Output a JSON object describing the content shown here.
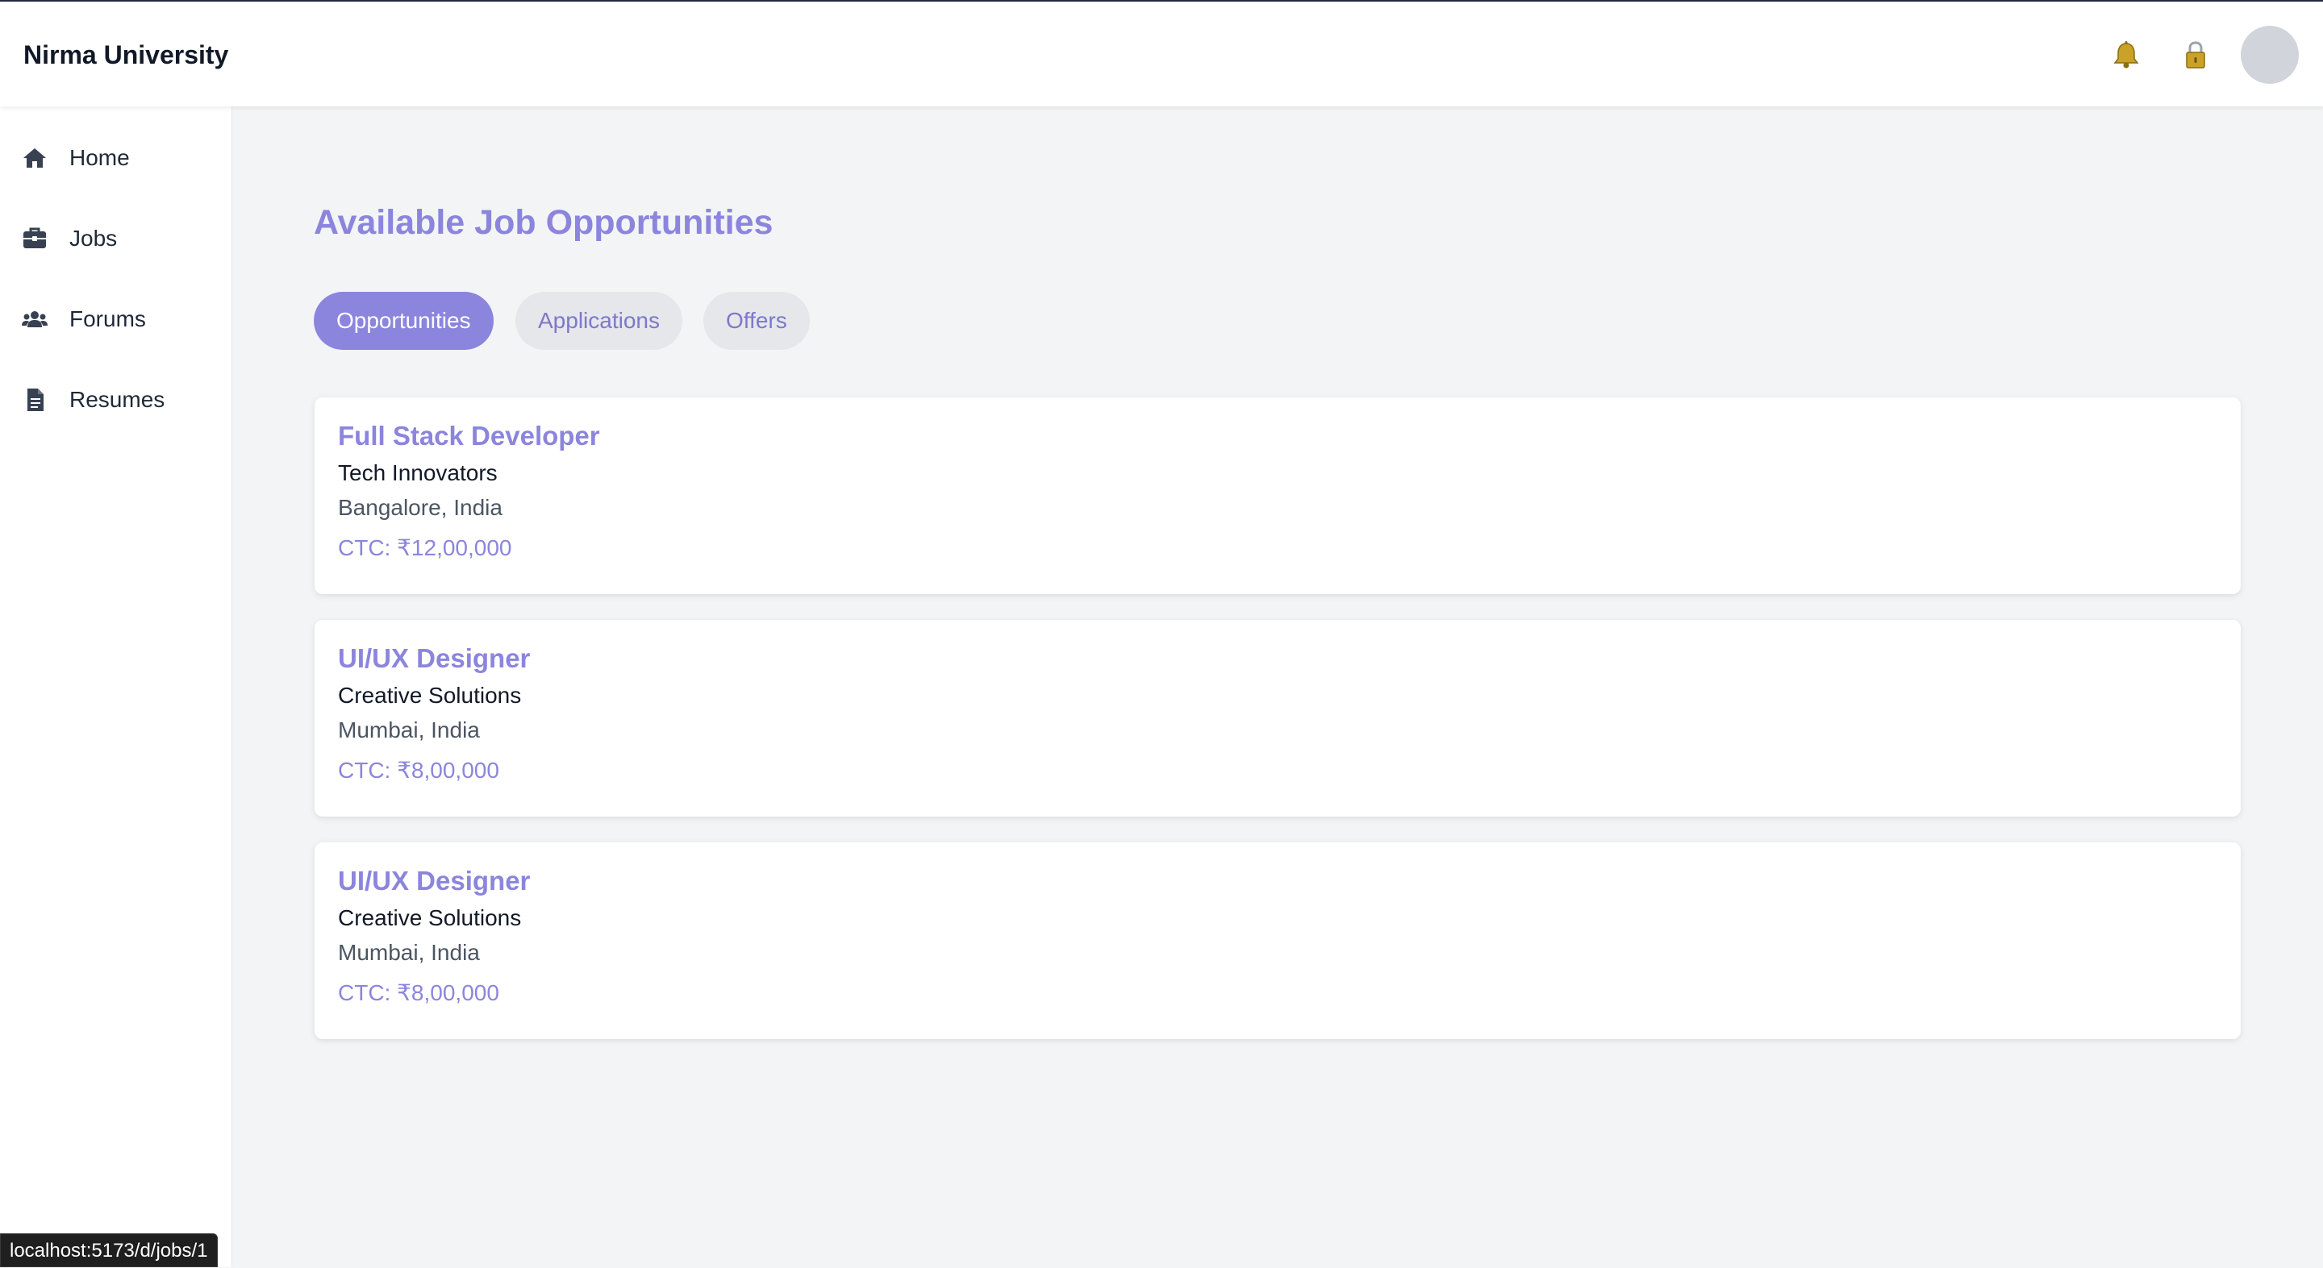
{
  "header": {
    "brand": "Nirma University",
    "icons": [
      "bell-icon",
      "lock-icon"
    ]
  },
  "sidebar": {
    "items": [
      {
        "label": "Home",
        "icon": "home-icon"
      },
      {
        "label": "Jobs",
        "icon": "briefcase-icon"
      },
      {
        "label": "Forums",
        "icon": "users-icon"
      },
      {
        "label": "Resumes",
        "icon": "document-icon"
      }
    ]
  },
  "main": {
    "title": "Available Job Opportunities",
    "tabs": [
      {
        "label": "Opportunities",
        "active": true
      },
      {
        "label": "Applications",
        "active": false
      },
      {
        "label": "Offers",
        "active": false
      }
    ],
    "jobs": [
      {
        "title": "Full Stack Developer",
        "company": "Tech Innovators",
        "location": "Bangalore, India",
        "ctc": "CTC: ₹12,00,000"
      },
      {
        "title": "UI/UX Designer",
        "company": "Creative Solutions",
        "location": "Mumbai, India",
        "ctc": "CTC: ₹8,00,000"
      },
      {
        "title": "UI/UX Designer",
        "company": "Creative Solutions",
        "location": "Mumbai, India",
        "ctc": "CTC: ₹8,00,000"
      }
    ]
  },
  "status_bar": {
    "url": "localhost:5173/d/jobs/1"
  },
  "colors": {
    "accent": "#8b85dd",
    "background": "#f3f4f6",
    "surface": "#ffffff"
  }
}
